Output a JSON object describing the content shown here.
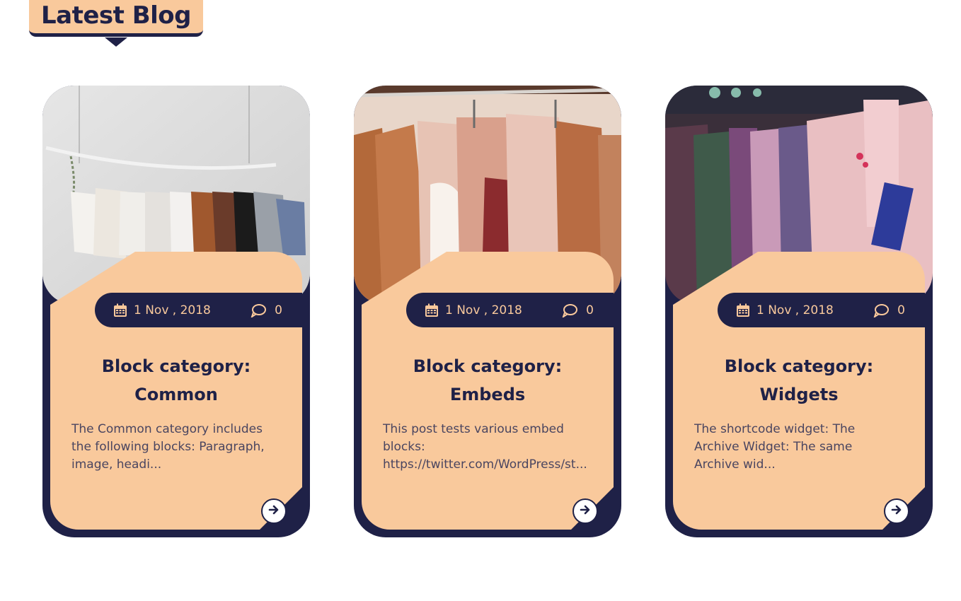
{
  "section": {
    "title": "Latest Blog"
  },
  "colors": {
    "navy": "#1f2147",
    "peach": "#f9c99c"
  },
  "posts": [
    {
      "date": "1 Nov , 2018",
      "comments": "0",
      "title_line1": "Block category:",
      "title_line2": "Common",
      "excerpt_lines": [
        "The Common category includes",
        "the following blocks: Paragraph,",
        "image, headi..."
      ],
      "image": "clothes-rack-white-wall",
      "icons": {
        "date": "calendar-icon",
        "comments": "comment-icon",
        "more": "arrow-right-icon"
      }
    },
    {
      "date": "1 Nov , 2018",
      "comments": "0",
      "title_line1": "Block category:",
      "title_line2": "Embeds",
      "excerpt_lines": [
        "This post tests various embed",
        "blocks:",
        "https://twitter.com/WordPress/st..."
      ],
      "image": "clothes-on-hangers-pink",
      "icons": {
        "date": "calendar-icon",
        "comments": "comment-icon",
        "more": "arrow-right-icon"
      }
    },
    {
      "date": "1 Nov , 2018",
      "comments": "0",
      "title_line1": "Block category:",
      "title_line2": "Widgets",
      "excerpt_lines": [
        "The shortcode widget: The",
        "Archive Widget: The same",
        "Archive wid..."
      ],
      "image": "shirts-in-store",
      "icons": {
        "date": "calendar-icon",
        "comments": "comment-icon",
        "more": "arrow-right-icon"
      }
    }
  ]
}
